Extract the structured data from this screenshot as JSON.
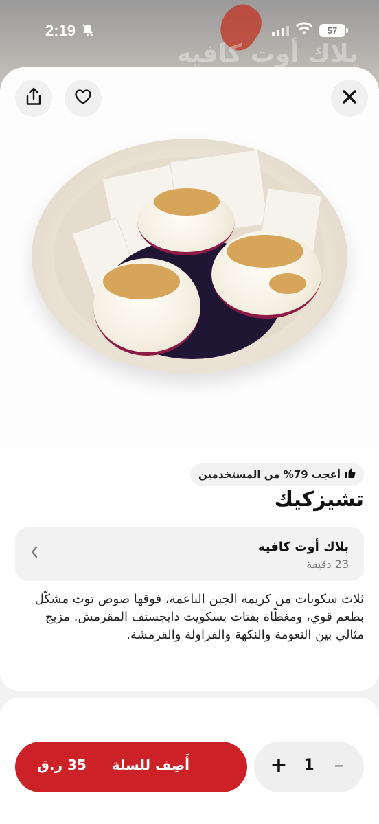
{
  "status_bar": {
    "time": "2:19",
    "battery": "57"
  },
  "backdrop": {
    "text": "بلاك أوت كافيه"
  },
  "product": {
    "likes_badge": "أعجب 79% من المستخدمين",
    "title": "تشيزكيك",
    "description": "ثلاث سكوبات من كريمة الجبن الناعمة، فوقها صوص توت مشكّل بطعم قوي، ومغطّاة بفتات بسكويت دايجستف المقرمش. مزيج مثالي بين النعومة والنكهة والفراولة والقرمشة."
  },
  "vendor": {
    "name": "بلاك أوت كافيه",
    "delivery_time": "23 دقيقة"
  },
  "cart": {
    "add_label": "أَضِف للسلة",
    "price": "35 ر.ق",
    "quantity": "1"
  },
  "icons": {
    "close": "close-icon",
    "favorite": "heart-icon",
    "share": "share-icon",
    "thumbs_up": "thumbs-up-icon",
    "chevron": "chevron-left-icon"
  },
  "colors": {
    "accent": "#cc2127"
  }
}
